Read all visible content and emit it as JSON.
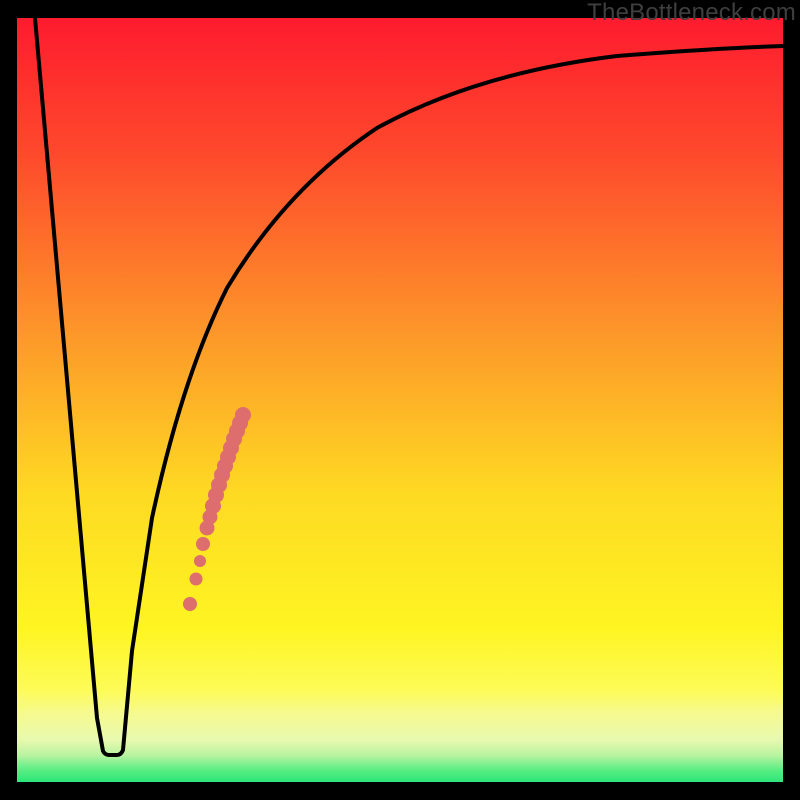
{
  "watermark": "TheBottleneck.com",
  "colors": {
    "gradient_top": "#fe1b2e",
    "gradient_mid1": "#fd8f27",
    "gradient_mid2": "#fef425",
    "gradient_band": "#f6fa8f",
    "gradient_green": "#34e97c",
    "curve_stroke": "#000000",
    "dot_fill": "#de6e6d",
    "frame_bg": "#000000"
  },
  "chart_data": {
    "type": "line",
    "title": "",
    "xlabel": "",
    "ylabel": "",
    "xlim": [
      0,
      766
    ],
    "ylim": [
      0,
      100
    ],
    "grid": false,
    "legend": false,
    "series": [
      {
        "name": "bottleneck-curve",
        "x": [
          18,
          40,
          60,
          78,
          89,
          97,
          113,
          140,
          180,
          230,
          290,
          360,
          440,
          530,
          630,
          720,
          765
        ],
        "y": [
          100,
          75,
          50,
          25,
          4,
          4,
          20,
          40,
          57,
          70,
          79,
          85,
          89,
          92,
          94,
          95.5,
          96
        ]
      }
    ],
    "annotations": {
      "dot_cluster": {
        "approx_x_range": [
          175,
          225
        ],
        "approx_y_range_pct": [
          23,
          48
        ],
        "count": 22
      }
    }
  }
}
